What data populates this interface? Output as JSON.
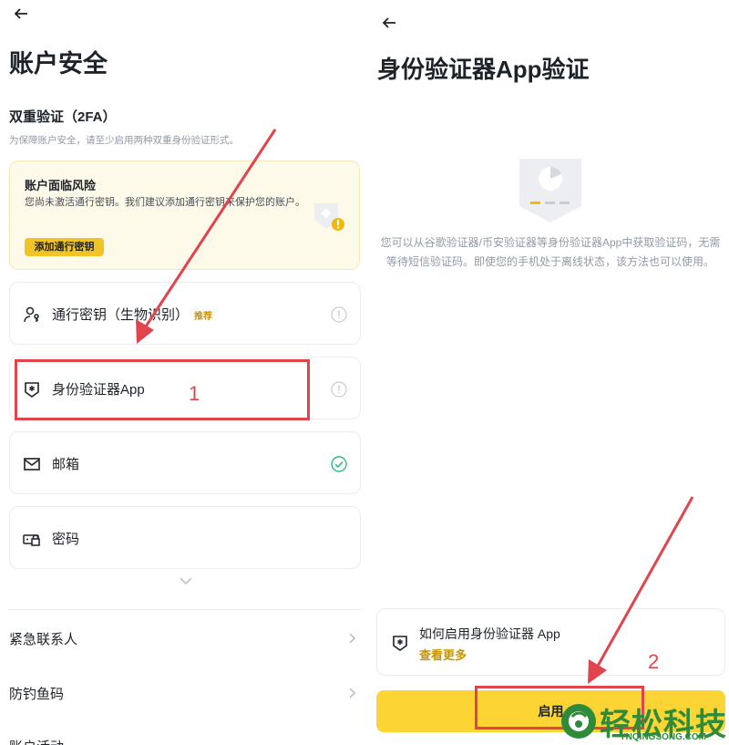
{
  "left": {
    "back_icon": "arrow-left-icon",
    "title": "账户安全",
    "section_title": "双重验证（2FA）",
    "section_hint": "为保障账户安全，请至少启用两种双重身份验证形式。",
    "risk": {
      "title": "账户面临风险",
      "text": "您尚未激活通行密钥。我们建议添加通行密钥来保护您的账户。",
      "button": "添加通行密钥"
    },
    "methods": [
      {
        "label": "通行密钥（生物识别）",
        "tag": "推荐",
        "icon": "passkey-user-icon",
        "status": "not-enabled"
      },
      {
        "label": "身份验证器App",
        "icon": "authenticator-shield-icon",
        "status": "not-enabled"
      },
      {
        "label": "邮箱",
        "icon": "mail-icon",
        "status": "enabled"
      },
      {
        "label": "密码",
        "icon": "password-lock-icon",
        "status": "none"
      }
    ],
    "list_rows": [
      {
        "label": "紧急联系人"
      },
      {
        "label": "防钓鱼码"
      },
      {
        "label": "账户活动"
      }
    ]
  },
  "right": {
    "back_icon": "arrow-left-icon",
    "title": "身份验证器App验证",
    "description": "您可以从谷歌验证器/币安验证器等身份验证器App中获取验证码，无需等待短信验证码。即使您的手机处于离线状态，该方法也可以使用。",
    "guide": {
      "title": "如何启用身份验证器 App",
      "link": "查看更多"
    },
    "enable_button": "启用"
  },
  "annotations": {
    "step1": "1",
    "step2": "2",
    "color": "#e0454d"
  },
  "watermark": {
    "main": "轻松科技",
    "sub": "YNQINGSONG.COM"
  },
  "colors": {
    "brand_yellow": "#fcd535",
    "text_dark": "#1e2329",
    "text_gray": "#929aa5",
    "success_green": "#2ebd85"
  }
}
